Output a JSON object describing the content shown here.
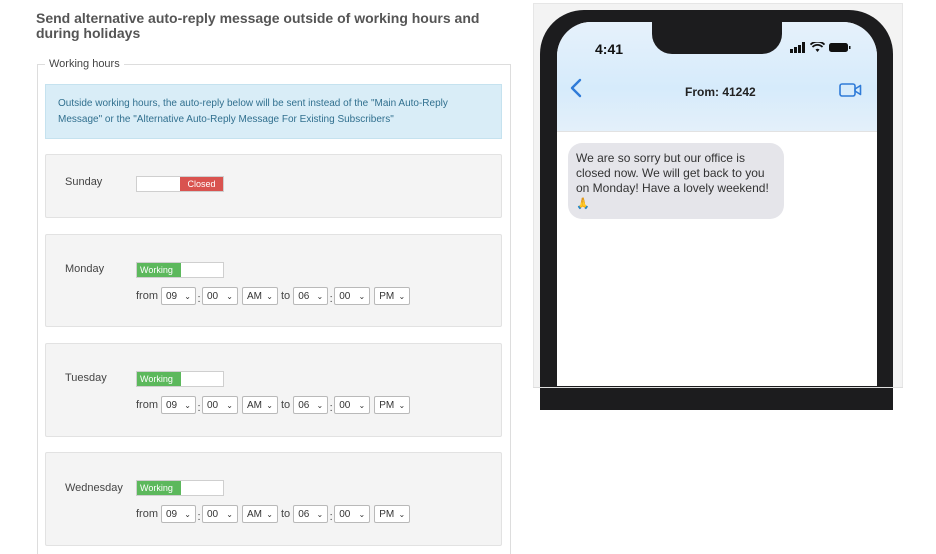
{
  "page_title": "Send alternative auto-reply message outside of working hours and during holidays",
  "section_legend": "Working hours",
  "notice_text": "Outside working hours, the auto-reply below will be sent instead of the \"Main Auto-Reply Message\" or the \"Alternative Auto-Reply Message For Existing Subscribers\"",
  "days": [
    {
      "name": "Sunday",
      "status": "Closed"
    },
    {
      "name": "Monday",
      "status": "Working",
      "from_label": "from",
      "to_label": "to",
      "start_hour": "09",
      "start_min": "00",
      "start_ampm": "AM",
      "end_hour": "06",
      "end_min": "00",
      "end_ampm": "PM"
    },
    {
      "name": "Tuesday",
      "status": "Working",
      "from_label": "from",
      "to_label": "to",
      "start_hour": "09",
      "start_min": "00",
      "start_ampm": "AM",
      "end_hour": "06",
      "end_min": "00",
      "end_ampm": "PM"
    },
    {
      "name": "Wednesday",
      "status": "Working",
      "from_label": "from",
      "to_label": "to",
      "start_hour": "09",
      "start_min": "00",
      "start_ampm": "AM",
      "end_hour": "06",
      "end_min": "00",
      "end_ampm": "PM"
    }
  ],
  "colon": ":",
  "phone": {
    "time": "4:41",
    "from_label": "From: 41242",
    "message": "We are so sorry but our office is closed now. We will get back to you on Monday! Have a lovely weekend!",
    "emoji": "🙏",
    "accent_color": "#2f7bd8"
  },
  "colors": {
    "working": "#5cb85c",
    "closed": "#d9534f",
    "notice_bg": "#d9edf7"
  }
}
